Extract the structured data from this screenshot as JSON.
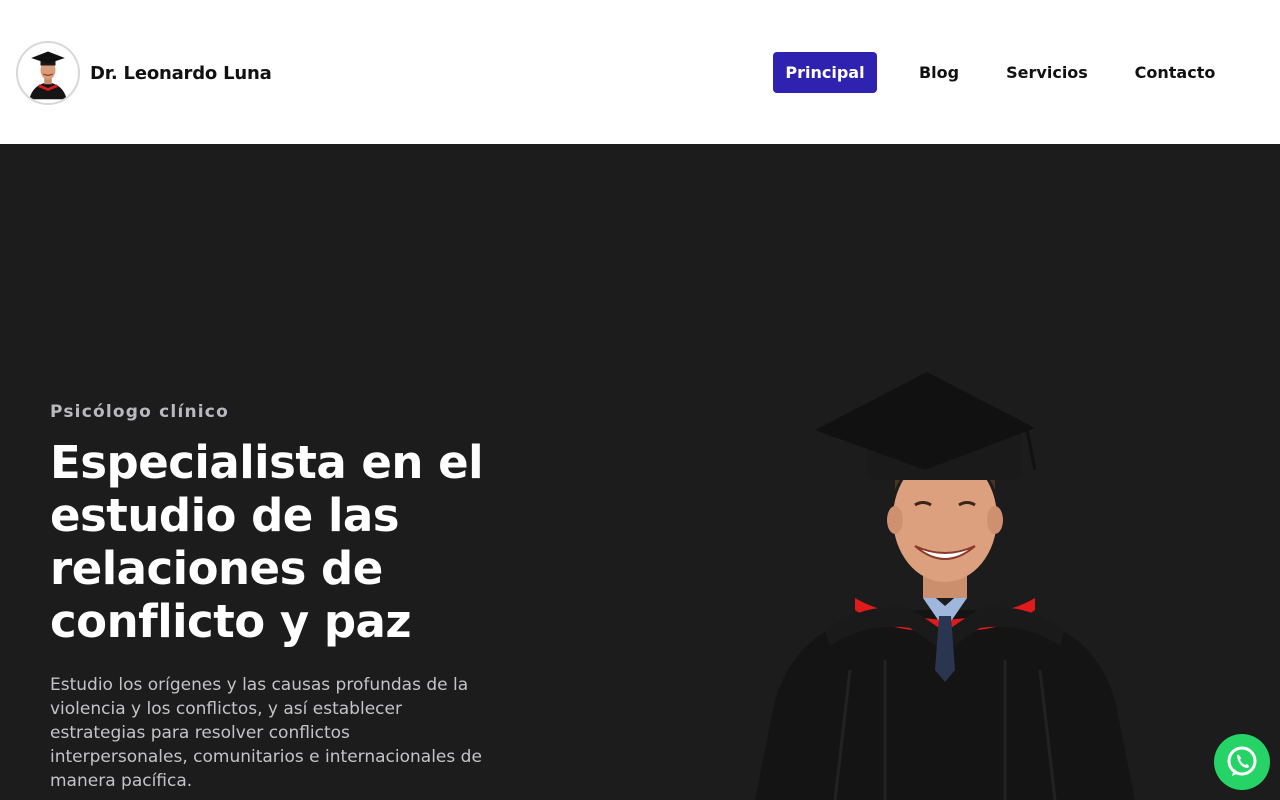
{
  "header": {
    "brand_name": "Dr. Leonardo Luna",
    "avatar_icon": "graduate-portrait-icon",
    "nav": [
      {
        "label": "Principal",
        "active": true
      },
      {
        "label": "Blog",
        "active": false
      },
      {
        "label": "Servicios",
        "active": false
      },
      {
        "label": "Contacto",
        "active": false
      }
    ]
  },
  "hero": {
    "eyebrow": "Psicólogo clínico",
    "headline": "Especialista en el estudio de las relaciones de conflicto y paz",
    "lead": "Estudio los orígenes y las causas profundas de la violencia y los conflictos, y así establecer estrategias para resolver conflictos interpersonales, comunitarios e internacionales de manera pacífica.",
    "portrait_icon": "graduate-portrait"
  },
  "floating": {
    "whatsapp_icon": "whatsapp-icon"
  },
  "colors": {
    "accent": "#2f22b0",
    "hero_bg": "#1c1c1d",
    "whatsapp": "#25d366",
    "gown_trim": "#e01b1b"
  }
}
